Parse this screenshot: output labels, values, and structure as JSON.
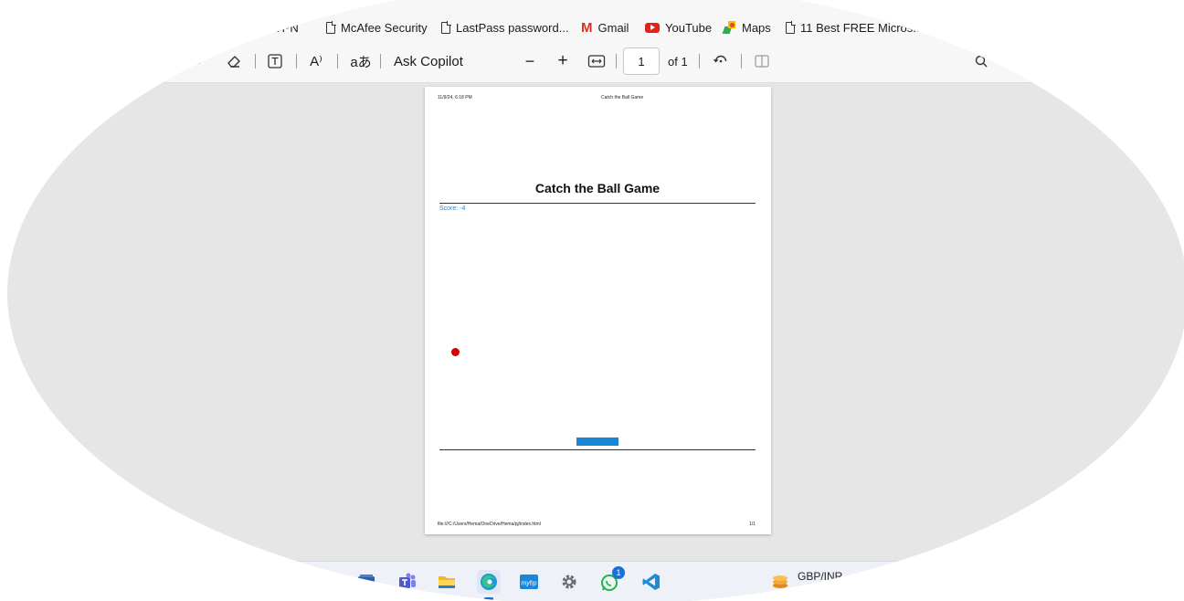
{
  "bookmarks": [
    {
      "label": "VPN",
      "icon": "page-icon"
    },
    {
      "label": "McAfee Security",
      "icon": "page-icon"
    },
    {
      "label": "LastPass password...",
      "icon": "page-icon"
    },
    {
      "label": "Gmail",
      "icon": "gmail-icon"
    },
    {
      "label": "YouTube",
      "icon": "youtube-icon"
    },
    {
      "label": "Maps",
      "icon": "maps-icon"
    },
    {
      "label": "11 Best FREE Micros...",
      "icon": "page-icon"
    }
  ],
  "toolbar": {
    "read_aloud": "A⁾",
    "translate": "aあ",
    "ask_copilot": "Ask Copilot",
    "zoom_out": "−",
    "zoom_in": "+",
    "page_number": "1",
    "page_total": "of 1"
  },
  "pdf": {
    "header_left": "11/9/24, 6:18 PM",
    "header_center": "Catch the Ball Game",
    "title": "Catch the Ball Game",
    "score": "Score: -4",
    "footer_left": "file:///C:/Users/Hema/OneDrive/Hema/pj/index.html",
    "footer_right": "1/1"
  },
  "taskbar": {
    "whatsapp_badge": "1",
    "widget_label": "GBP/INR"
  },
  "colors": {
    "ball": "#d40000",
    "paddle": "#1b86d3",
    "score_text": "#2a7fd4",
    "viewer_background": "#e6e6e6"
  }
}
